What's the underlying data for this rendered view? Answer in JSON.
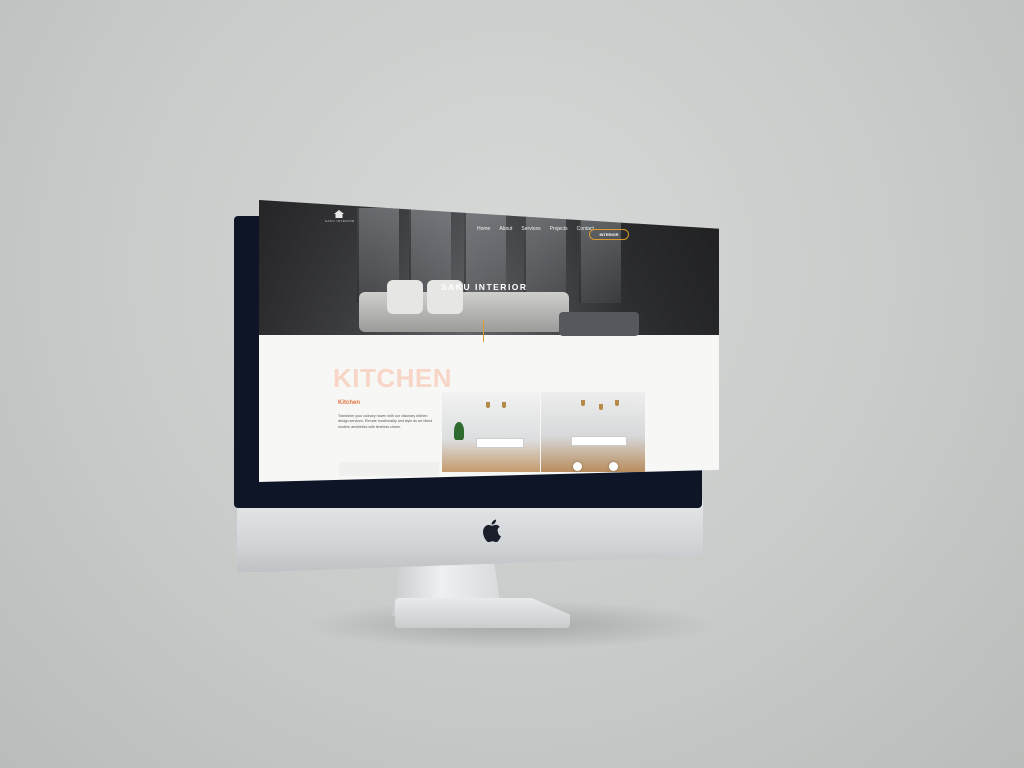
{
  "site": {
    "logo_text": "SAKU INTERIOR",
    "nav": [
      "Home",
      "About",
      "Services",
      "Projects",
      "Contact"
    ],
    "cta_label": "INTERIOR",
    "hero_title": "SAKU INTERIOR"
  },
  "section": {
    "watermark": "KITCHEN",
    "title": "Kitchen",
    "description": "Transform your culinary haven with our visionary kitchen design services. Elevate functionality and style as we blend modern aesthetics with timeless charm."
  },
  "colors": {
    "accent": "#d79a2b",
    "section_title": "#e2733e",
    "watermark": "#f8d6c7",
    "bezel": "#0e1526"
  },
  "icons": {
    "logo": "house-logo-icon",
    "monitor_logo": "apple-logo-icon"
  }
}
